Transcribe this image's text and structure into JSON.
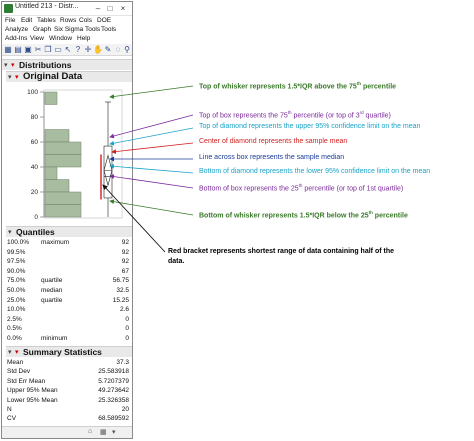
{
  "window": {
    "title": "Untitled 213 - Distr...",
    "minimize_glyph": "–",
    "maximize_glyph": "□",
    "close_glyph": "×"
  },
  "menubar": {
    "row1": [
      "File",
      "Edit",
      "Tables",
      "Rows",
      "Cols",
      "DOE"
    ],
    "row2": [
      "Analyze",
      "Graph",
      "Six Sigma Tools",
      "Tools"
    ],
    "row3": [
      "Add-Ins",
      "View",
      "Window",
      "Help"
    ]
  },
  "toolbar": {
    "icons": [
      "new-table",
      "open",
      "save",
      "cut",
      "copy",
      "paste",
      "select",
      "help",
      "lasso",
      "hand",
      "brush",
      "scroll",
      "zoom"
    ]
  },
  "outline": {
    "distributions": "Distributions",
    "original_data": "Original Data",
    "quantiles": "Quantiles",
    "summary": "Summary Statistics"
  },
  "axis": {
    "ticks": [
      "100",
      "80",
      "60",
      "40",
      "20",
      "0"
    ]
  },
  "chart_data": {
    "type": "bar",
    "title": "",
    "xlabel": "",
    "ylabel": "",
    "ylim": [
      0,
      100
    ],
    "orientation": "horizontal-histogram",
    "bins": [
      {
        "from": 90,
        "to": 100,
        "count": 1
      },
      {
        "from": 80,
        "to": 90,
        "count": 0
      },
      {
        "from": 70,
        "to": 80,
        "count": 0
      },
      {
        "from": 60,
        "to": 70,
        "count": 2
      },
      {
        "from": 50,
        "to": 60,
        "count": 3
      },
      {
        "from": 40,
        "to": 50,
        "count": 3
      },
      {
        "from": 30,
        "to": 40,
        "count": 1
      },
      {
        "from": 20,
        "to": 30,
        "count": 2
      },
      {
        "from": 10,
        "to": 20,
        "count": 3
      },
      {
        "from": 0,
        "to": 10,
        "count": 3
      }
    ],
    "box": {
      "min": 0,
      "q1": 15.25,
      "median": 32.5,
      "q3": 56.75,
      "max": 92,
      "whisker_low": 0,
      "whisker_high": 92,
      "mean": 37.3,
      "upper_ci": 49.27,
      "lower_ci": 25.33,
      "shortest_half": [
        14,
        50
      ]
    }
  },
  "quantiles": [
    {
      "pct": "100.0%",
      "label": "maximum",
      "value": "92"
    },
    {
      "pct": "99.5%",
      "label": "",
      "value": "92"
    },
    {
      "pct": "97.5%",
      "label": "",
      "value": "92"
    },
    {
      "pct": "90.0%",
      "label": "",
      "value": "67"
    },
    {
      "pct": "75.0%",
      "label": "quartile",
      "value": "56.75"
    },
    {
      "pct": "50.0%",
      "label": "median",
      "value": "32.5"
    },
    {
      "pct": "25.0%",
      "label": "quartile",
      "value": "15.25"
    },
    {
      "pct": "10.0%",
      "label": "",
      "value": "2.6"
    },
    {
      "pct": "2.5%",
      "label": "",
      "value": "0"
    },
    {
      "pct": "0.5%",
      "label": "",
      "value": "0"
    },
    {
      "pct": "0.0%",
      "label": "minimum",
      "value": "0"
    }
  ],
  "summary": [
    {
      "label": "Mean",
      "value": "37.3"
    },
    {
      "label": "Std Dev",
      "value": "25.583918"
    },
    {
      "label": "Std Err Mean",
      "value": "5.7207379"
    },
    {
      "label": "Upper 95% Mean",
      "value": "49.273642"
    },
    {
      "label": "Lower 95% Mean",
      "value": "25.326358"
    },
    {
      "label": "N",
      "value": "20"
    },
    {
      "label": "CV",
      "value": "68.589592"
    }
  ],
  "statusbar": {
    "icons": [
      "home-icon",
      "grid-icon",
      "dropdown-icon"
    ]
  },
  "annotations": [
    {
      "id": "whisker-top",
      "pre": "Top of whisker represents 1.5*IQR above the 75",
      "sup": "th",
      "post": " percentile",
      "color": "#3a7a2a",
      "bold": true
    },
    {
      "id": "box-top",
      "pre": "Top of box represents the 75",
      "sup": "th",
      "post": " percentile (or top of 3",
      "sup2": "rd",
      "post2": " quartile)",
      "color": "#7a2a9a",
      "bold": false
    },
    {
      "id": "diamond-top",
      "pre": "Top of diamond represents the upper 95% confidence limit on the mean",
      "color": "#1aa3c8",
      "bold": false
    },
    {
      "id": "diamond-center",
      "pre": "Center of diamond represents the sample mean",
      "color": "#d21f1f",
      "bold": false
    },
    {
      "id": "median-line",
      "pre": "Line across box represents the sample median",
      "color": "#1a3a9a",
      "bold": false
    },
    {
      "id": "diamond-bottom",
      "pre": "Bottom of diamond represents the lower 95% confidence limit on the mean",
      "color": "#1aa3c8",
      "bold": false
    },
    {
      "id": "box-bottom",
      "pre": "Bottom of box represents the 25",
      "sup": "th",
      "post": " percentile (or top of 1st quartile)",
      "color": "#7a2a9a",
      "bold": false
    },
    {
      "id": "whisker-bottom",
      "pre": "Bottom of whisker represents 1.5*IQR below the 25",
      "sup": "th",
      "post": " percentile",
      "color": "#3a7a2a",
      "bold": true
    }
  ],
  "red_bracket_note": {
    "line1": "Red bracket represents shortest range of data containing half of the",
    "line2": "data."
  },
  "colors": {
    "whisker_annotation": "#3a7a2a",
    "box_annotation": "#7a2a9a",
    "diamond_annotation": "#1aa3c8",
    "mean_annotation": "#d21f1f",
    "median_annotation": "#1a3a9a",
    "histogram_fill": "#a8bca0",
    "red_bracket": "#d21f1f"
  }
}
